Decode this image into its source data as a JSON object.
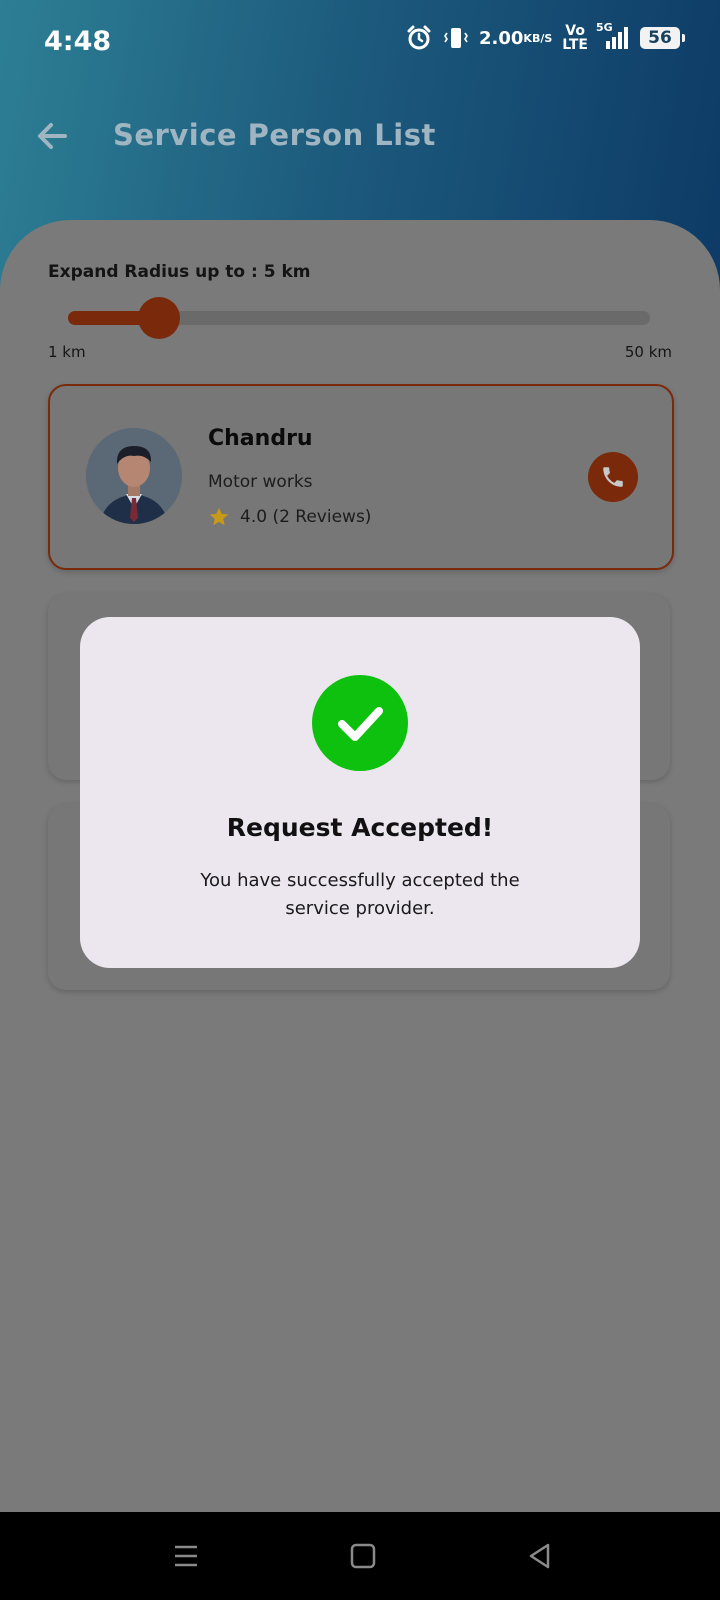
{
  "status_bar": {
    "time": "4:48",
    "net_speed": "2.00",
    "net_speed_unit": "KB/S",
    "volte_top": "Vo",
    "volte_bottom": "LTE",
    "network": "5G",
    "battery": "56",
    "icons": [
      "alarm-icon",
      "vibrate-icon",
      "signal-icon",
      "battery-icon"
    ]
  },
  "app_bar": {
    "title": "Service Person List",
    "back_icon": "arrow-left-icon"
  },
  "radius": {
    "label": "Expand Radius up to : 5 km",
    "min_label": "1 km",
    "max_label": "50 km",
    "min": 1,
    "max": 50,
    "value": 5
  },
  "providers": [
    {
      "name": "Chandru",
      "service": "Motor works",
      "rating_text": "4.0 (2 Reviews)",
      "selected": true
    }
  ],
  "dialog": {
    "title": "Request Accepted!",
    "message": "You have successfully accepted the service provider.",
    "icon": "check-circle-icon"
  },
  "colors": {
    "accent": "#c44a12",
    "success": "#0ec10e",
    "star": "#e8b21c"
  }
}
